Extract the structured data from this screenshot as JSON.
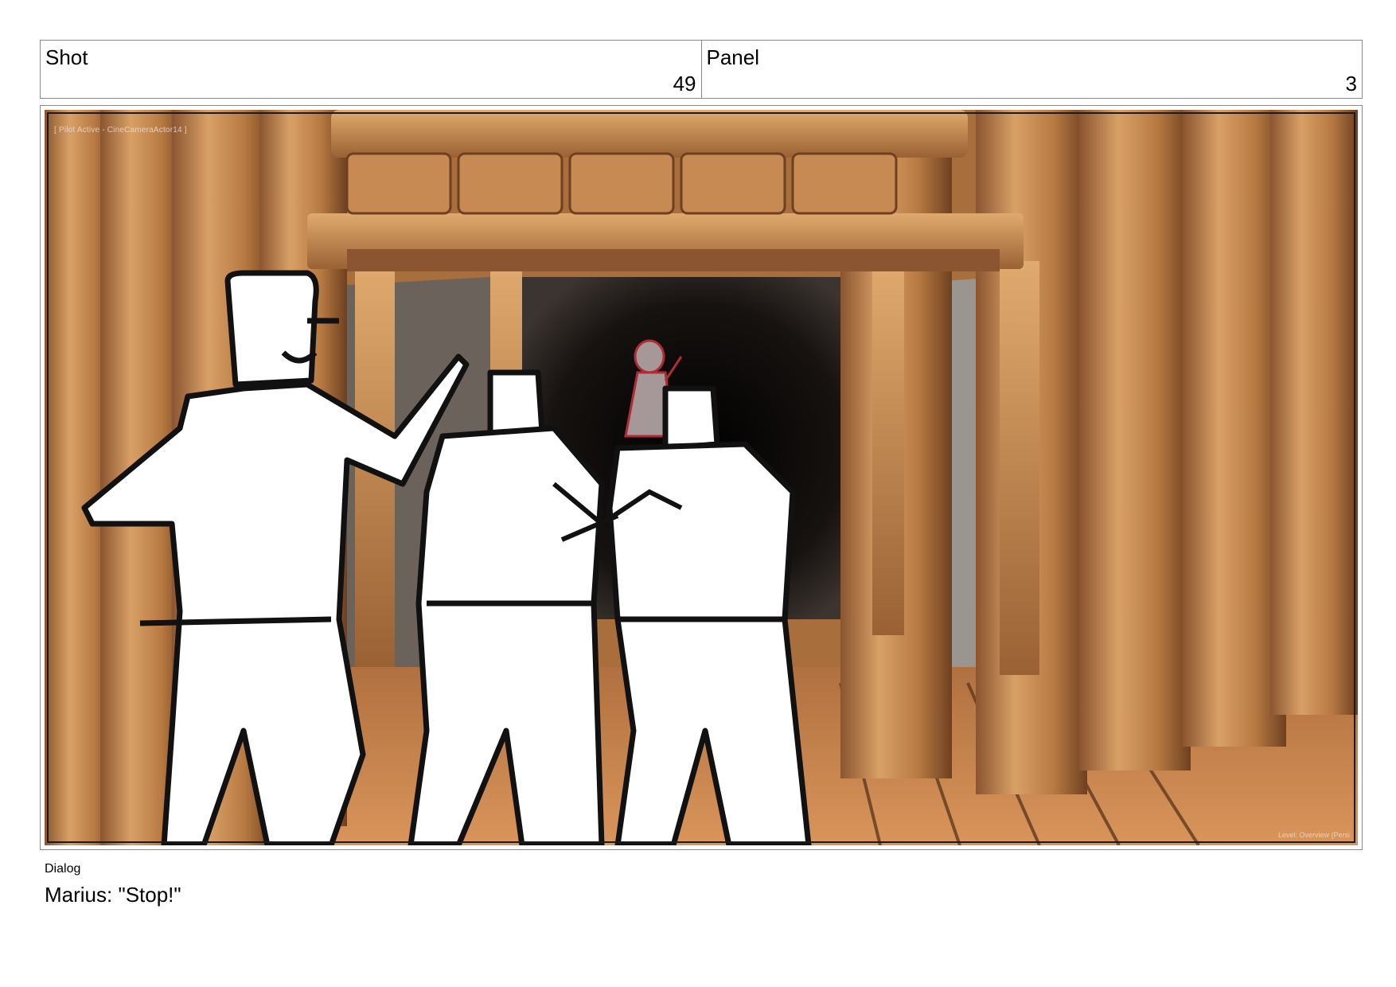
{
  "shot": {
    "label": "Shot",
    "value": "49"
  },
  "panel": {
    "label": "Panel",
    "value": "3"
  },
  "viewport": {
    "camera_tag": "[ Pilot Active - CineCameraActor14 ]",
    "level_tag": "Level: Overview (Persi"
  },
  "dialog": {
    "label": "Dialog",
    "text": "Marius: \"Stop!\""
  },
  "colors": {
    "wood_light": "#d39a5e",
    "wood_mid": "#b77a42",
    "wood_dark": "#7a4a26",
    "tunnel_dark": "#0c0a08",
    "sketch_line": "#111111",
    "sketch_fill": "#ffffff",
    "red_sketch": "#c0303a",
    "border": "#8a8a8a"
  }
}
